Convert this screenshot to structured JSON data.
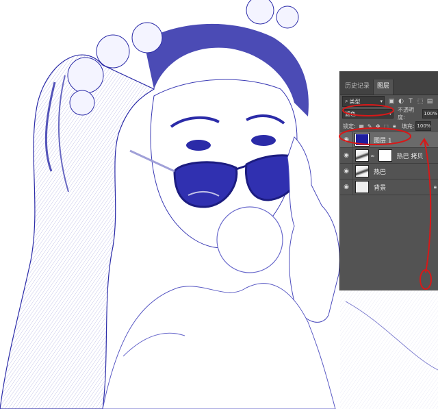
{
  "panel": {
    "tabs": [
      {
        "label": "历史记录"
      },
      {
        "label": "图层"
      }
    ],
    "filter": {
      "kind_label": "类型",
      "icons": [
        "image-filter-icon",
        "adjustment-filter-icon",
        "text-filter-icon",
        "shape-filter-icon",
        "smart-object-filter-icon"
      ]
    },
    "blend": {
      "mode": "滤色",
      "opacity_label": "不透明度:",
      "opacity_value": "100%"
    },
    "lock": {
      "label": "锁定:",
      "fill_label": "填充:",
      "fill_value": "100%"
    },
    "layers": [
      {
        "name": "图层 1",
        "visible": true,
        "selected": true,
        "thumb_color": "#1e1ea0"
      },
      {
        "name": "热巴 拷贝",
        "visible": true,
        "selected": false
      },
      {
        "name": "热巴",
        "visible": true,
        "selected": false
      },
      {
        "name": "背景",
        "visible": true,
        "selected": false,
        "locked": true
      }
    ],
    "bottom_icons": [
      "link-icon",
      "fx-icon",
      "mask-icon",
      "adjustment-icon",
      "folder-icon",
      "new-layer-icon",
      "trash-icon"
    ]
  },
  "colors": {
    "panel_bg": "#535353",
    "sketch_blue": "#2b2ba8",
    "annotation_red": "#d81818"
  }
}
